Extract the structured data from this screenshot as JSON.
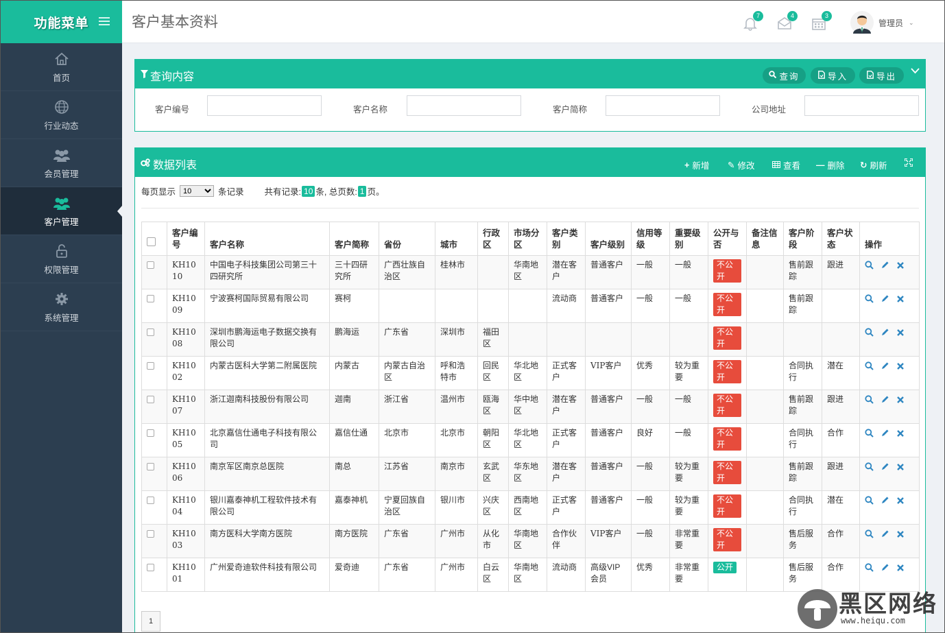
{
  "sidebar": {
    "brand": "功能菜单",
    "items": [
      {
        "label": "首页",
        "icon": "home-icon"
      },
      {
        "label": "行业动态",
        "icon": "globe-icon"
      },
      {
        "label": "会员管理",
        "icon": "users-icon"
      },
      {
        "label": "客户管理",
        "icon": "users-icon",
        "active": true
      },
      {
        "label": "权限管理",
        "icon": "lock-icon"
      },
      {
        "label": "系统管理",
        "icon": "gear-icon"
      }
    ]
  },
  "header": {
    "title": "客户基本资料",
    "bell_badge": "7",
    "mail_badge": "4",
    "calendar_badge": "3",
    "user_name": "管理员"
  },
  "query": {
    "title": "查询内容",
    "buttons": {
      "search": "查询",
      "import": "导入",
      "export": "导出"
    },
    "fields": {
      "code": "客户编号",
      "name": "客户名称",
      "short": "客户简称",
      "address": "公司地址"
    }
  },
  "list": {
    "title": "数据列表",
    "tools": {
      "add": "新增",
      "edit": "修改",
      "view": "查看",
      "delete": "删除",
      "refresh": "刷新"
    },
    "per_page_label": "每页显示",
    "per_page_value": "10",
    "records_suffix": "条记录",
    "total_label": "共有记录:",
    "total": "10",
    "total_suffix": "条, 总页数:",
    "pages": "1",
    "pages_suffix": "页。",
    "columns": [
      "客户编号",
      "客户名称",
      "客户简称",
      "省份",
      "城市",
      "行政区",
      "市场分区",
      "客户类别",
      "客户级别",
      "信用等级",
      "重要级别",
      "公开与否",
      "备注信息",
      "客户阶段",
      "客户状态",
      "操作"
    ],
    "rows": [
      [
        "KH1010",
        "中国电子科技集团公司第三十四研究所",
        "三十四研究所",
        "广西壮族自治区",
        "桂林市",
        "",
        "华南地区",
        "潜在客户",
        "普通客户",
        "一般",
        "一般",
        "不公开",
        "",
        "售前跟踪",
        "跟进"
      ],
      [
        "KH1009",
        "宁波赛柯国际贸易有限公司",
        "赛柯",
        "",
        "",
        "",
        "",
        "流动商",
        "普通客户",
        "一般",
        "一般",
        "不公开",
        "",
        "售前跟踪",
        ""
      ],
      [
        "KH1008",
        "深圳市鹏海运电子数据交换有限公司",
        "鹏海运",
        "广东省",
        "深圳市",
        "福田区",
        "",
        "",
        "",
        "",
        "",
        "不公开",
        "",
        "",
        ""
      ],
      [
        "KH1002",
        "内蒙古医科大学第二附属医院",
        "内蒙古",
        "内蒙古自治区",
        "呼和浩特市",
        "回民区",
        "华北地区",
        "正式客户",
        "VIP客户",
        "优秀",
        "较为重要",
        "不公开",
        "",
        "合同执行",
        "潜在"
      ],
      [
        "KH1007",
        "浙江迦南科技股份有限公司",
        "迦南",
        "浙江省",
        "温州市",
        "瓯海区",
        "华中地区",
        "潜在客户",
        "普通客户",
        "一般",
        "一般",
        "不公开",
        "",
        "售前跟踪",
        "跟进"
      ],
      [
        "KH1005",
        "北京嘉信仕通电子科技有限公司",
        "嘉信仕通",
        "北京市",
        "北京市",
        "朝阳区",
        "华北地区",
        "正式客户",
        "普通客户",
        "良好",
        "一般",
        "不公开",
        "",
        "合同执行",
        "合作"
      ],
      [
        "KH1006",
        "南京军区南京总医院",
        "南总",
        "江苏省",
        "南京市",
        "玄武区",
        "华东地区",
        "潜在客户",
        "普通客户",
        "一般",
        "较为重要",
        "不公开",
        "",
        "售前跟踪",
        "跟进"
      ],
      [
        "KH1004",
        "银川嘉泰神机工程软件技术有限公司",
        "嘉泰神机",
        "宁夏回族自治区",
        "银川市",
        "兴庆区",
        "西南地区",
        "正式客户",
        "普通客户",
        "一般",
        "较为重要",
        "不公开",
        "",
        "合同执行",
        "潜在"
      ],
      [
        "KH1003",
        "南方医科大学南方医院",
        "南方医院",
        "广东省",
        "广州市",
        "从化市",
        "华南地区",
        "合作伙伴",
        "VIP客户",
        "一般",
        "非常重要",
        "不公开",
        "",
        "售后服务",
        "合作"
      ],
      [
        "KH1001",
        "广州爱奇迪软件科技有限公司",
        "爱奇迪",
        "广东省",
        "广州市",
        "白云区",
        "华南地区",
        "流动商",
        "高级VIP会员",
        "优秀",
        "非常重要",
        "公开",
        "",
        "售后服务",
        "合作"
      ]
    ],
    "page_button": "1"
  },
  "watermark": {
    "text": "黑区网络",
    "url": "www.heiqu.com"
  },
  "colors": {
    "accent": "#1abc9c",
    "sidebar": "#2c3e50",
    "danger": "#e74c3c"
  }
}
